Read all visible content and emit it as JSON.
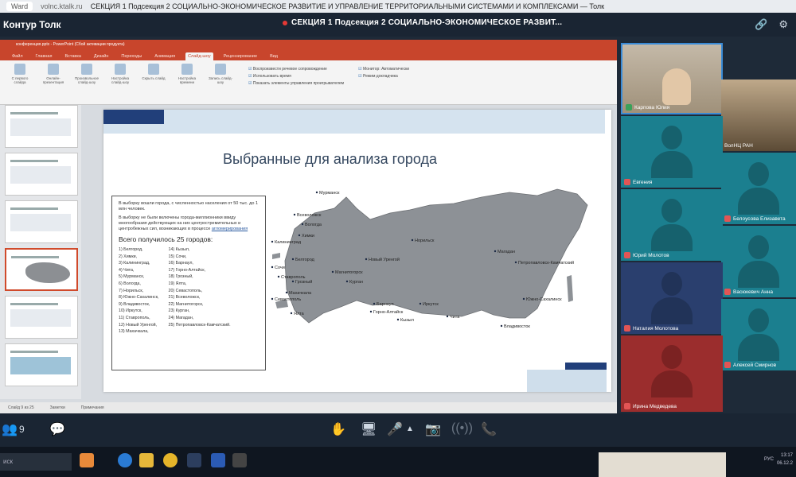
{
  "browser": {
    "tab": "Ward",
    "url": "volnc.ktalk.ru",
    "title": "СЕКЦИЯ 1 Подсекция 2 СОЦИАЛЬНО-ЭКОНОМИЧЕСКОЕ РАЗВИТИЕ И УПРАВЛЕНИЕ ТЕРРИТОРИАЛЬНЫМИ СИСТЕМАМИ И КОМПЛЕКСАМИ — Толк"
  },
  "app": {
    "name": "Контур Толк",
    "conference_title": "СЕКЦИЯ 1 Подсекция 2 СОЦИАЛЬНО-ЭКОНОМИЧЕСКОЕ РАЗВИТ..."
  },
  "ppt": {
    "title": "конференция.pptx - PowerPoint (Сбой активации продукта)",
    "menu": [
      "Файл",
      "Главная",
      "Вставка",
      "Дизайн",
      "Переходы",
      "Анимация",
      "Слайд-шоу",
      "Рецензирование",
      "Вид"
    ],
    "active_menu": "Слайд-шоу",
    "ribbon_buttons": [
      "С первого слайда",
      "Онлайн-презентация",
      "Произвольное слайд-шоу",
      "Настройка слайд-шоу",
      "Скрыть слайд",
      "Настройка времени",
      "Запись слайд-шоу"
    ],
    "ribbon_checks": [
      "Воспроизвести речевое сопровождение",
      "Использовать время",
      "Показать элементы управления проигрывателем"
    ],
    "monitor_checks": [
      "Монитор: Автоматически",
      "Режим докладчика"
    ],
    "status": [
      "Слайд 9 из 25",
      "Заметки",
      "Примечания"
    ]
  },
  "slide": {
    "title": "Выбранные для анализа города",
    "intro_1": "В выборку вошли города, с численностью населения от 50 тыс. до 1 млн человек.",
    "intro_2": "В выборку не были включены города-миллионники ввиду многообразия действующих на них центростремительных и центробежных сил, возникающих в процессе",
    "intro_2_link": "агломерирования",
    "total": "Всего получилось 25 городов:",
    "cities_left": [
      "1) Белгород,",
      "2) Химки,",
      "3) Калининград,",
      "4) Чита,",
      "5) Мурманск,",
      "6) Вологда,",
      "7) Норильск,",
      "8) Южно-Сахалинск,",
      "9) Владивосток,",
      "10) Иркутск,",
      "11) Ставрополь,",
      "12) Новый Уренгой,",
      "13) Махачкала,"
    ],
    "cities_right": [
      "14) Кызыл,",
      "15) Сочи,",
      "16) Барнаул,",
      "17) Горно-Алтайск,",
      "18) Грозный,",
      "19) Ялта,",
      "20) Севастополь,",
      "21) Всеволожск,",
      "22) Магнитогорск,",
      "23) Курган,",
      "24) Магадан,",
      "25) Петропавловск-Камчатский."
    ],
    "map_labels": [
      "Мурманск",
      "Калининград",
      "Всеволожск",
      "Вологда",
      "Химки",
      "Белгород",
      "Ставрополь",
      "Сочи",
      "Грозный",
      "Махачкала",
      "Севастополь",
      "Ялта",
      "Новый Уренгой",
      "Норильск",
      "Магнитогорск",
      "Курган",
      "Барнаул",
      "Горно-Алтайск",
      "Кызыл",
      "Иркутск",
      "Чита",
      "Магадан",
      "Петропавловск-Камчатский",
      "Южно-Сахалинск",
      "Владивосток"
    ]
  },
  "participants": [
    {
      "name": "Карпова Юлия",
      "camera": true
    },
    {
      "name": "ВолНЦ РАН",
      "camera": true
    },
    {
      "name": "Евгения",
      "camera": false
    },
    {
      "name": "Белоусова Елизавета",
      "camera": false
    },
    {
      "name": "Юрий Молотов",
      "camera": false
    },
    {
      "name": "Васюкевич Анна",
      "camera": false
    },
    {
      "name": "Наталия Молотова",
      "camera": false
    },
    {
      "name": "Алексей Смирнов",
      "camera": false
    },
    {
      "name": "Ирина Медведева",
      "camera": false
    }
  ],
  "controls": {
    "participants_count": "9"
  },
  "taskbar": {
    "search": "иск",
    "lang": "РУС",
    "time": "13:17",
    "date": "06.12.2"
  },
  "colors": {
    "ppt_accent": "#c8452c",
    "app_bg": "#1a2533",
    "tile_teal": "#1b7f8f",
    "tile_red": "#9b2d2d",
    "tile_navy": "#2a3f6e"
  }
}
